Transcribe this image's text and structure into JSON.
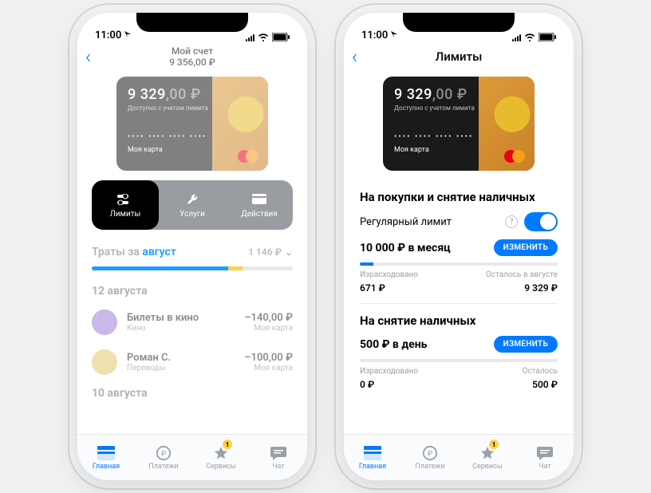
{
  "status": {
    "time": "11:00"
  },
  "left": {
    "title": "Мой счет",
    "balance": "9 356,00 ₽",
    "card": {
      "balance_main": "9 329",
      "balance_dec": ",00 ₽",
      "subtitle": "Доступно с учетом лимита",
      "dots": "•••• •••• •••• ••••",
      "name": "Моя карта"
    },
    "actions": [
      {
        "label": "Лимиты"
      },
      {
        "label": "Услуги"
      },
      {
        "label": "Действия"
      }
    ],
    "spend": {
      "prefix": "Траты за ",
      "month": "август",
      "total": "1 146 ₽"
    },
    "groups": [
      {
        "date": "12 августа",
        "tx": [
          {
            "title": "Билеты в кино",
            "cat": "Кино",
            "amount": "–140,00 ₽",
            "src": "Моя карта"
          },
          {
            "title": "Роман С.",
            "cat": "Переводы",
            "amount": "–100,00 ₽",
            "src": "Моя карта"
          }
        ]
      },
      {
        "date": "10 августа",
        "tx": []
      }
    ]
  },
  "right": {
    "title": "Лимиты",
    "card": {
      "balance_main": "9 329",
      "balance_dec": ",00 ₽",
      "subtitle": "Доступно с учетом лимита",
      "dots": "•••• •••• •••• ••••",
      "name": "Моя карта"
    },
    "section1": {
      "heading": "На покупки и снятие наличных",
      "toggle_label": "Регулярный лимит",
      "amount": "10 000 ₽ в месяц",
      "button": "ИЗМЕНИТЬ",
      "spent_label": "Израсходовано",
      "spent": "671 ₽",
      "left_label": "Осталось в августе",
      "left": "9 329 ₽",
      "progress_pct": 7
    },
    "section2": {
      "heading": "На снятие наличных",
      "amount": "500 ₽ в день",
      "button": "ИЗМЕНИТЬ",
      "spent_label": "Израсходовано",
      "spent": "0 ₽",
      "left_label": "Осталось",
      "left": "500 ₽",
      "progress_pct": 0
    }
  },
  "tabs": [
    {
      "label": "Главная"
    },
    {
      "label": "Платежи"
    },
    {
      "label": "Сервисы",
      "badge": "1"
    },
    {
      "label": "Чат"
    }
  ]
}
